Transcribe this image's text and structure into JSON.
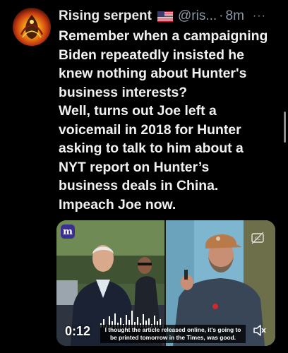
{
  "author": {
    "name": "Rising serpent",
    "flag_icon": "us-flag-icon",
    "handle": "@ris...",
    "separator": "·",
    "time": "8m",
    "more_label": "···"
  },
  "tweet": {
    "lines": [
      "Remember when a campaigning",
      "Biden repeatedly insisted he",
      "knew nothing about Hunter's",
      "business interests?",
      "Well, turns out Joe left a",
      "voicemail in 2018 for Hunter",
      "asking to talk to him about a",
      "NYT report on Hunter’s",
      "business deals in China.",
      "Impeach Joe now."
    ]
  },
  "media": {
    "badge": "m",
    "timestamp": "0:12",
    "caption_line1": "I thought the article released online, it's going to",
    "caption_line2": "be printed tomorrow in the Times, was good.",
    "mute_icon": "speaker-muted-icon",
    "corner_icon": "caption-settings-icon"
  },
  "colors": {
    "background": "#000000",
    "text": "#e7e9ea",
    "muted": "#8b98a5"
  }
}
